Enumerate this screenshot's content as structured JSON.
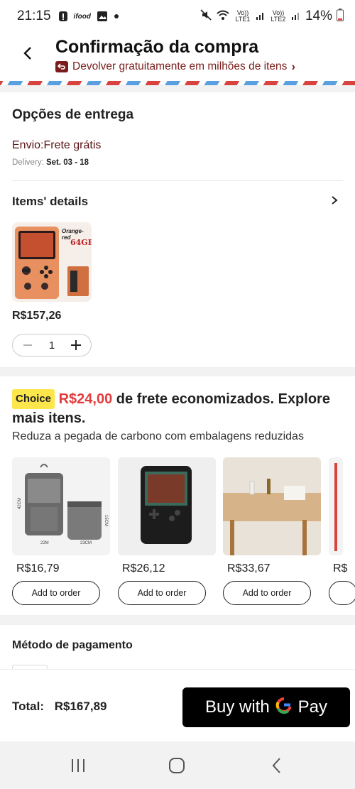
{
  "status_bar": {
    "time": "21:15",
    "icons": [
      "alert-icon",
      "ifood-icon",
      "gallery-icon",
      "dot-icon",
      "mute-icon",
      "wifi-icon",
      "signal-lte1-icon",
      "signal-lte2-icon",
      "battery-icon"
    ],
    "ifood_label": "ifood",
    "lte1": "Vo)) LTE1",
    "lte2": "Vo)) LTE2",
    "battery": "14%"
  },
  "header": {
    "title": "Confirmação da compra",
    "return_text": "Devolver gratuitamente em milhões de itens",
    "chevron": "›"
  },
  "delivery": {
    "title": "Opções de entrega",
    "shipping": "Envio:Frete grátis",
    "delivery_label": "Delivery:",
    "delivery_dates": "Set. 03 - 18"
  },
  "items": {
    "title": "Items' details",
    "product": {
      "color_label": "Orange-red",
      "storage_label": "64GB",
      "price": "R$157,26",
      "quantity": "1"
    }
  },
  "choice": {
    "badge": "Choice",
    "amount": "R$24,00",
    "headline": "de frete economizados. Explore mais itens.",
    "subtitle": "Reduza a pegada de carbono com embalagens reduzidas",
    "products": [
      {
        "price": "R$16,79",
        "button": "Add to order",
        "dims": [
          "42CM",
          "22M",
          "23CM",
          "15CM"
        ]
      },
      {
        "price": "R$26,12",
        "button": "Add to order"
      },
      {
        "price": "R$33,67",
        "button": "Add to order"
      },
      {
        "price": "R$",
        "button": ""
      }
    ]
  },
  "payment": {
    "title": "Método de pagamento"
  },
  "footer": {
    "total_label": "Total:",
    "total_value": "R$167,89",
    "buy_label": "Buy with",
    "pay_label": "Pay",
    "g_letter": "G"
  },
  "colors": {
    "brand_red": "#e23c3c",
    "dark_red": "#7a1c1c",
    "choice_yellow": "#fce64b"
  }
}
